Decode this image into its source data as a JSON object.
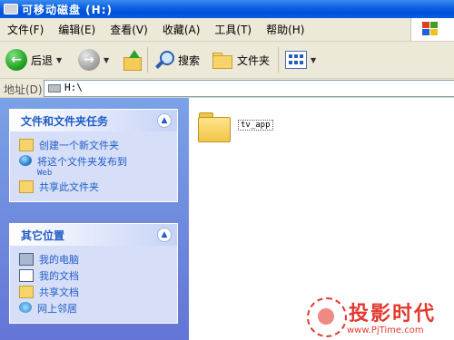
{
  "window": {
    "title": "可移动磁盘 (H:)"
  },
  "menu": {
    "items": [
      "文件(F)",
      "编辑(E)",
      "查看(V)",
      "收藏(A)",
      "工具(T)",
      "帮助(H)"
    ]
  },
  "toolbar": {
    "back_label": "后退",
    "search_label": "搜索",
    "folders_label": "文件夹",
    "icons": {
      "back": "back-arrow-icon",
      "forward": "forward-arrow-icon",
      "up": "up-folder-icon",
      "search": "search-icon",
      "folders": "folder-icon",
      "views": "views-icon"
    }
  },
  "address": {
    "label": "地址(D)",
    "value": "H:\\"
  },
  "tasks_panel": {
    "title": "文件和文件夹任务",
    "items": [
      {
        "label": "创建一个新文件夹",
        "icon": "new-folder-icon"
      },
      {
        "label": "将这个文件夹发布到",
        "label2": "Web",
        "icon": "globe-icon"
      },
      {
        "label": "共享此文件夹",
        "icon": "share-folder-icon"
      }
    ]
  },
  "places_panel": {
    "title": "其它位置",
    "items": [
      {
        "label": "我的电脑",
        "icon": "computer-icon"
      },
      {
        "label": "我的文档",
        "icon": "documents-icon"
      },
      {
        "label": "共享文档",
        "icon": "shared-docs-icon"
      },
      {
        "label": "网上邻居",
        "icon": "network-icon"
      }
    ]
  },
  "content": {
    "folders": [
      {
        "name": "tv_app"
      }
    ]
  },
  "watermark": {
    "name": "投影时代",
    "url": "www.PjTime.com"
  },
  "colors": {
    "title_bar": "#0a5fe0",
    "task_pane": "#6375d6",
    "task_link": "#215dc6",
    "watermark": "#e23a30"
  }
}
